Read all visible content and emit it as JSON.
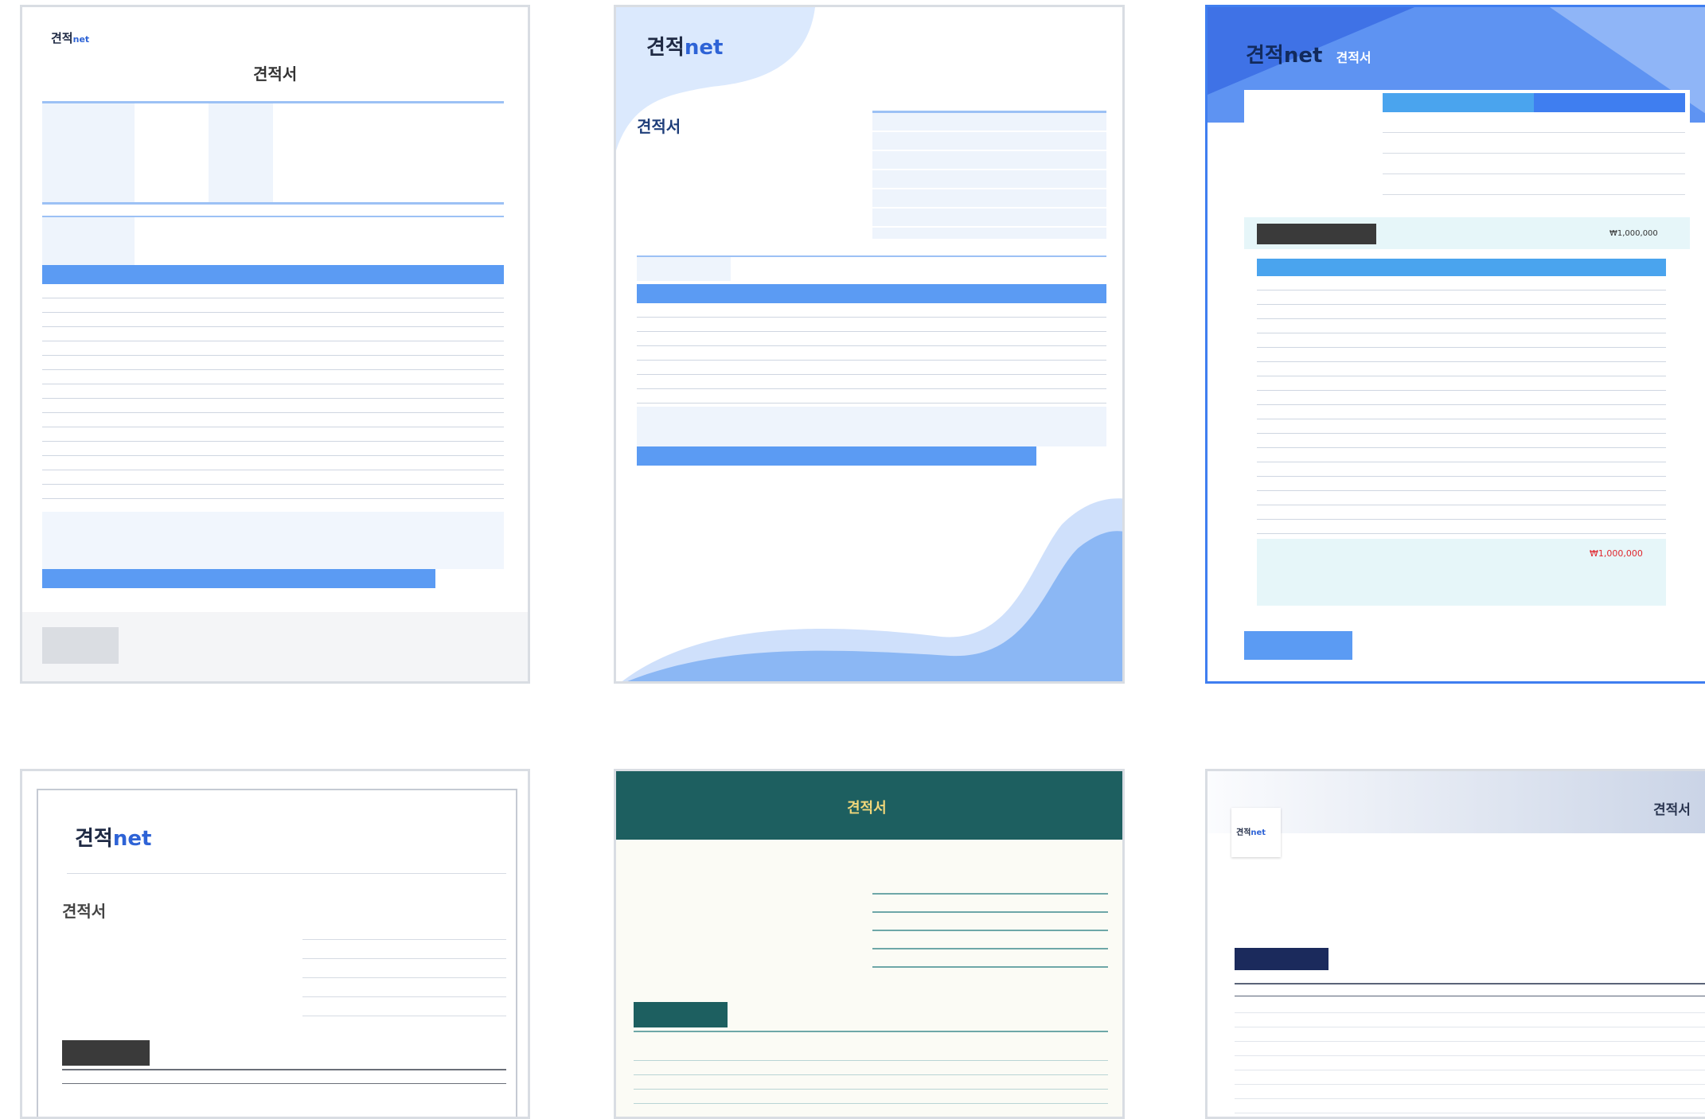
{
  "template1": {
    "logo_main": "견적",
    "logo_net": "net",
    "title": "견적서"
  },
  "template2": {
    "logo_main": "견적",
    "logo_net": "net",
    "title": "견적서"
  },
  "template3": {
    "logo_main": "견적",
    "logo_net": "net",
    "title": "견적서",
    "amount_text": "₩1,000,000",
    "amount_text_2": "₩1,000,000"
  },
  "template4": {
    "logo_main": "견적",
    "logo_net": "net",
    "title": "견적서"
  },
  "template5": {
    "title": "견적서"
  },
  "template6": {
    "logo_main": "견적",
    "logo_net": "net",
    "title": "견적서"
  },
  "colors": {
    "blue": "#5b9bf3",
    "deep_blue": "#3f7ef0",
    "teal": "#1d5f60",
    "navy": "#1b2a5c",
    "dark": "#3a3a3a",
    "red": "#e0262d"
  }
}
